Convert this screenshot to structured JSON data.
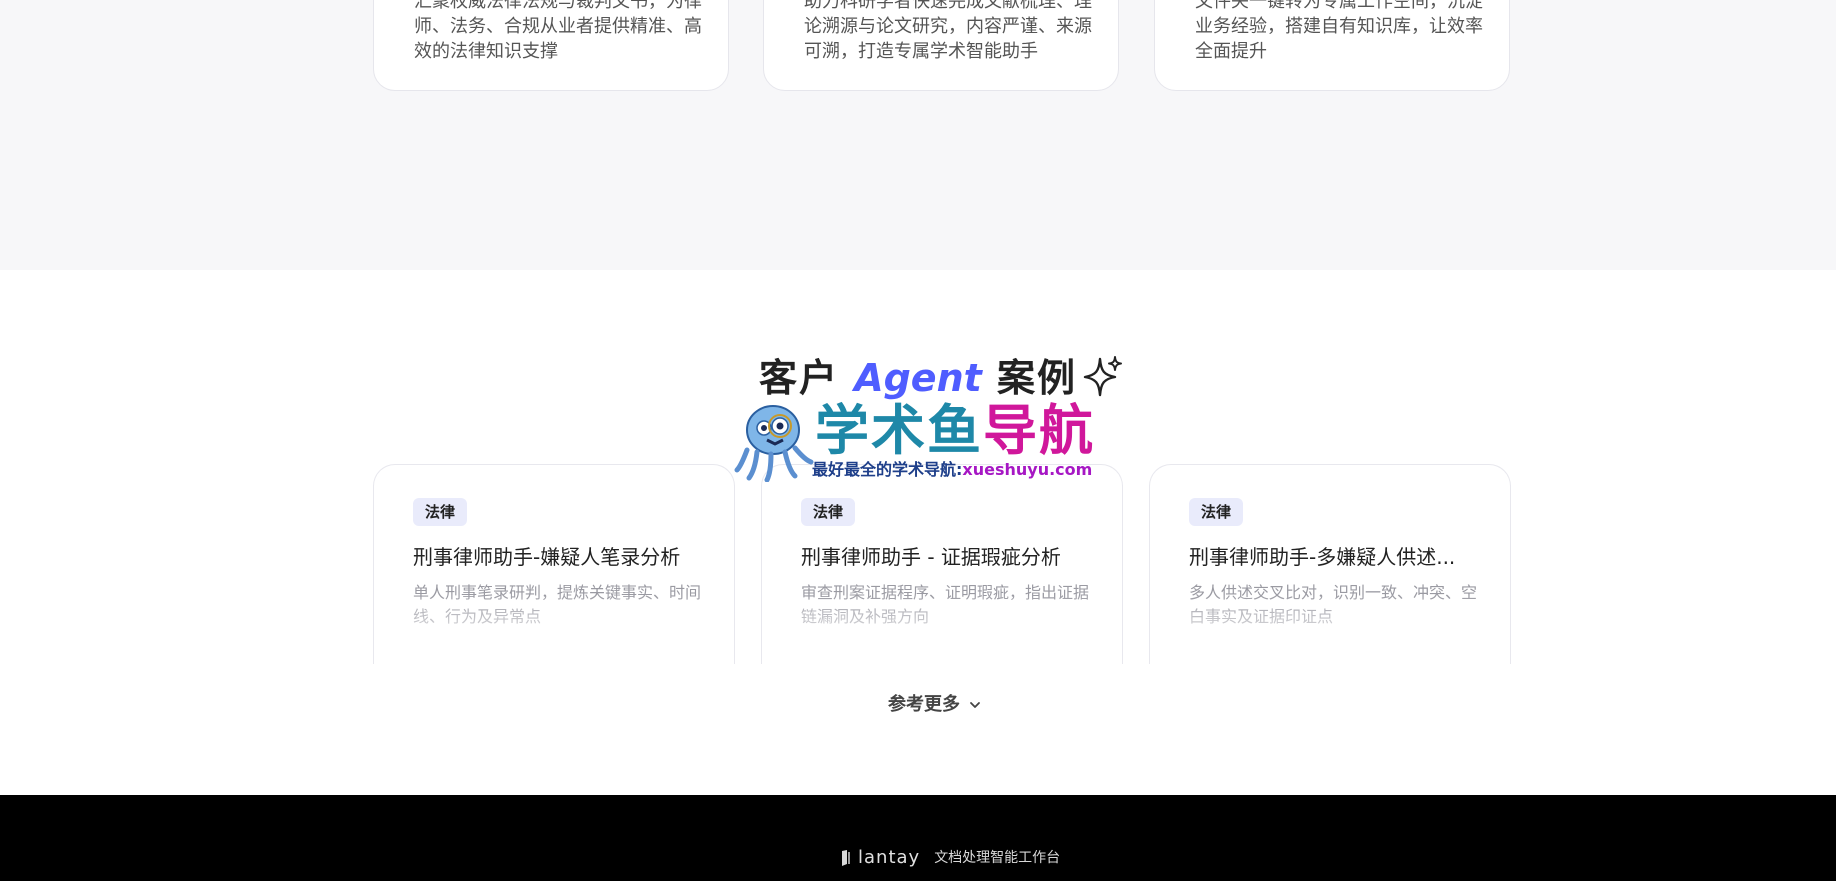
{
  "feature_cards": [
    {
      "text": "汇聚权威法律法规与裁判文书，为律师、法务、合规从业者提供精准、高效的法律知识支撑"
    },
    {
      "text": "助力科研学者快速完成文献梳理、理论溯源与论文研究，内容严谨、来源可溯，打造专属学术智能助手"
    },
    {
      "text": "文件夹一键转为专属工作空间，沉淀业务经验，搭建自有知识库，让效率全面提升"
    }
  ],
  "section": {
    "title_prefix": "客户",
    "title_accent": "Agent",
    "title_suffix": "案例"
  },
  "watermark": {
    "name_part1": "学术鱼",
    "name_part2": "导航",
    "sub_part1": "最好最全的学术导航:",
    "sub_part2": "xueshuyu.com"
  },
  "cases": [
    {
      "tag": "法律",
      "title": "刑事律师助手-嫌疑人笔录分析",
      "desc": "单人刑事笔录研判，提炼关键事实、时间线、行为及异常点"
    },
    {
      "tag": "法律",
      "title": "刑事律师助手 - 证据瑕疵分析",
      "desc": "审查刑案证据程序、证明瑕疵，指出证据链漏洞及补强方向"
    },
    {
      "tag": "法律",
      "title": "刑事律师助手-多嫌疑人供述...",
      "desc": "多人供述交叉比对，识别一致、冲突、空白事实及证据印证点"
    }
  ],
  "more_button": {
    "label": "参考更多"
  },
  "footer": {
    "brand": "lantay",
    "slogan": "文档处理智能工作台"
  },
  "colors": {
    "accent": "#4f5dff",
    "tag_bg": "#e9ebfb",
    "footer_bg": "#000000",
    "section_bg": "#f7f7f9"
  },
  "icons": {
    "sparkle": "sparkle-icon",
    "chevron": "chevron-down-icon",
    "logo": "lantay-logo-icon",
    "mascot": "octopus-mascot-icon"
  }
}
